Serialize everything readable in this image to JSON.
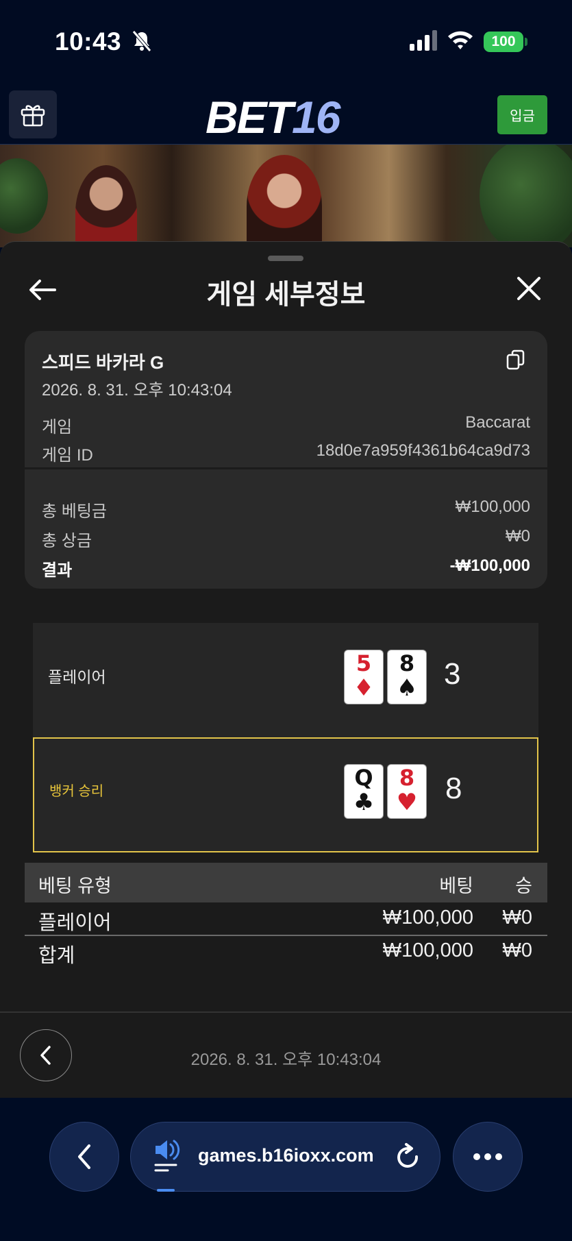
{
  "status_bar": {
    "time": "10:43",
    "battery": "100"
  },
  "header": {
    "logo_white": "BET",
    "logo_blue": "16",
    "deposit_label": "입금"
  },
  "sheet": {
    "title": "게임 세부정보",
    "game_name": "스피드 바카라 G",
    "datetime": "2026. 8. 31. 오후 10:43:04",
    "details": [
      {
        "label": "게임",
        "value": "Baccarat"
      },
      {
        "label": "게임 ID",
        "value": "18d0e7a959f4361b64ca9d73"
      }
    ],
    "summary": [
      {
        "label": "총 베팅금",
        "value": "₩100,000"
      },
      {
        "label": "총 상금",
        "value": "₩0"
      },
      {
        "label": "결과",
        "value": "-₩100,000"
      }
    ],
    "hands": [
      {
        "label": "플레이어",
        "cards": [
          {
            "rank": "5",
            "suit": "♦",
            "color": "red"
          },
          {
            "rank": "8",
            "suit": "♠",
            "color": "black"
          }
        ],
        "score": "3",
        "winner": false
      },
      {
        "label": "뱅커 승리",
        "cards": [
          {
            "rank": "Q",
            "suit": "♣",
            "color": "black"
          },
          {
            "rank": "8",
            "suit": "♥",
            "color": "red"
          }
        ],
        "score": "8",
        "winner": true
      }
    ],
    "bets_table": {
      "headers": {
        "type": "베팅 유형",
        "bet": "베팅",
        "win": "승"
      },
      "rows": [
        {
          "type": "플레이어",
          "bet": "₩100,000",
          "win": "₩0"
        }
      ],
      "total": {
        "type": "합계",
        "bet": "₩100,000",
        "win": "₩0"
      }
    },
    "footer_datetime": "2026. 8. 31. 오후 10:43:04"
  },
  "browser": {
    "url": "games.b16ioxx.com"
  },
  "colors": {
    "accent_green": "#2e9a3a",
    "winner_gold": "#e3c44a",
    "logo_blue": "#9fb4f5"
  }
}
